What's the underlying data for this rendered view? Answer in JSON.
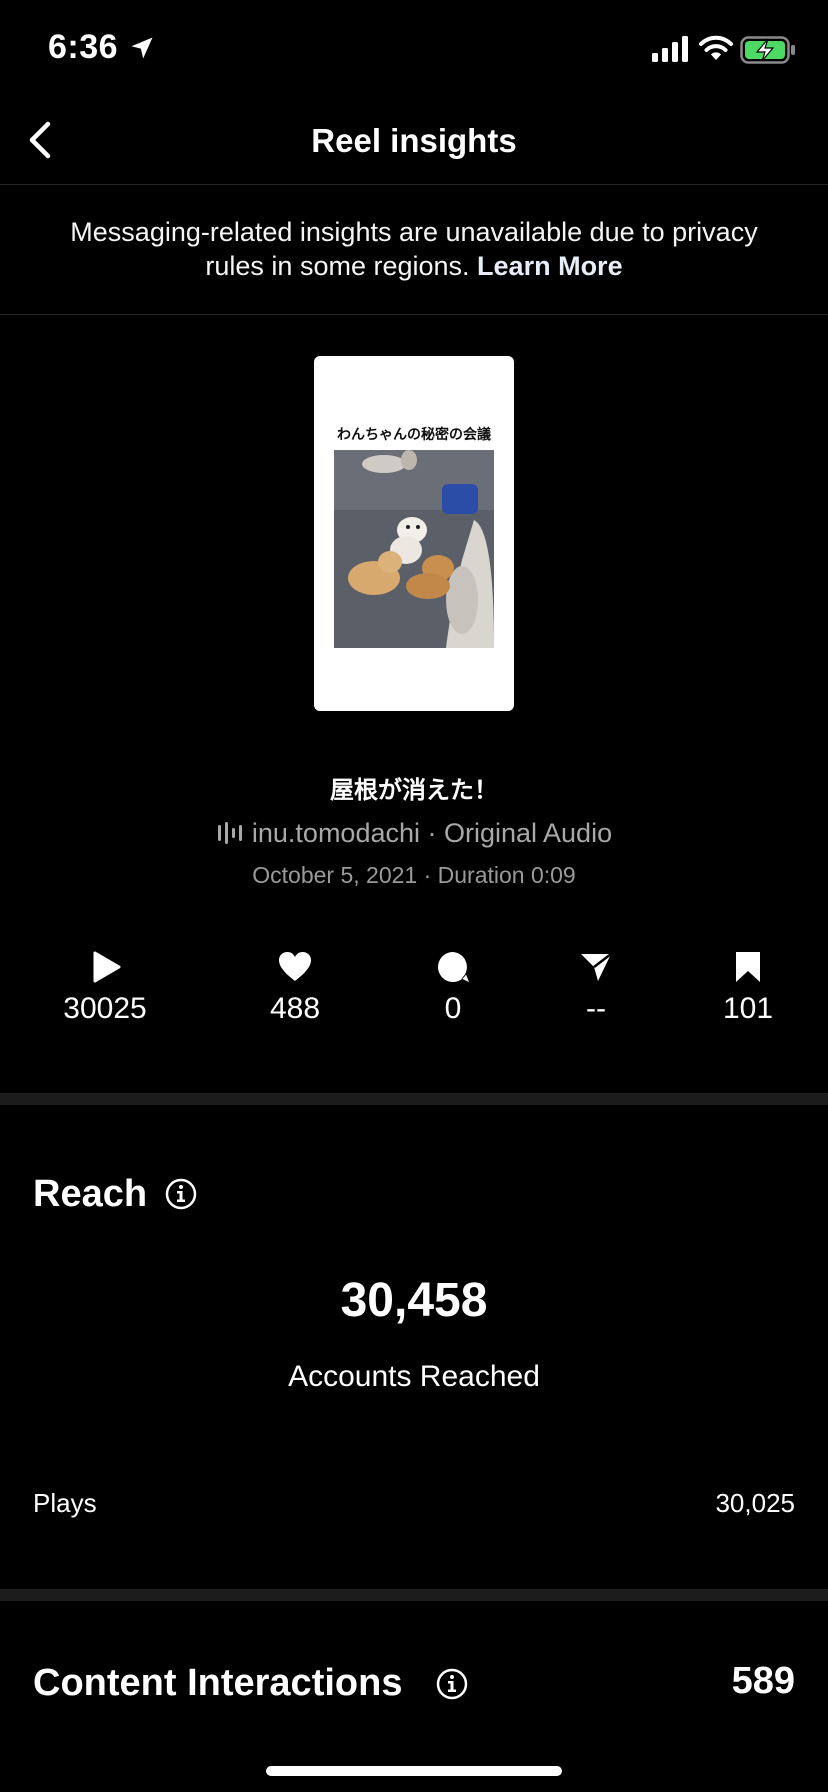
{
  "status_bar": {
    "time": "6:36"
  },
  "header": {
    "title": "Reel insights"
  },
  "notice": {
    "text": "Messaging-related insights are unavailable due to privacy rules in some regions.",
    "link_label": "Learn More"
  },
  "reel": {
    "thumbnail_caption": "わんちゃんの秘密の会議",
    "title": "屋根が消えた！",
    "audio": "inu.tomodachi · Original Audio",
    "date_duration": "October 5, 2021 · Duration 0:09"
  },
  "stats": {
    "plays": "30025",
    "likes": "488",
    "comments": "0",
    "shares": "--",
    "saves": "101"
  },
  "reach": {
    "title": "Reach",
    "accounts_reached": "30,458",
    "accounts_reached_label": "Accounts Reached",
    "plays_label": "Plays",
    "plays_value": "30,025"
  },
  "interactions": {
    "title": "Content Interactions",
    "value": "589"
  },
  "colors": {
    "background": "#000000",
    "muted_text": "#a8a8a8",
    "divider": "#1c1c1c",
    "battery_green": "#4cd964"
  }
}
